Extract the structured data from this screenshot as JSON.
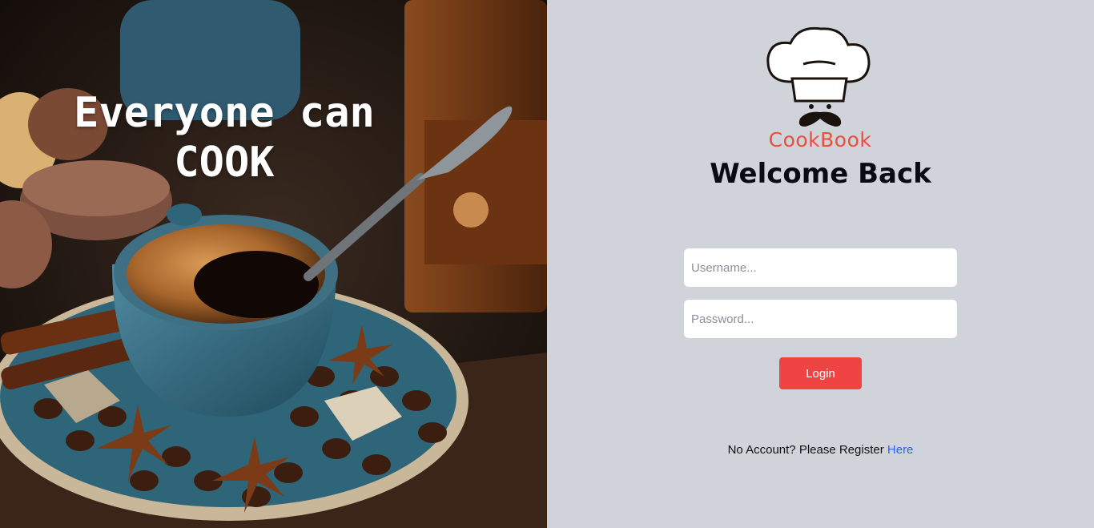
{
  "hero": {
    "line1": "Everyone can",
    "line2": "COOK"
  },
  "brand": {
    "name": "CookBook",
    "color": "#e94f3b"
  },
  "login_form": {
    "title": "Welcome Back",
    "username_placeholder": "Username...",
    "password_placeholder": "Password...",
    "login_label": "Login",
    "register_prompt": "No Account? Please Register",
    "register_link": "Here"
  },
  "colors": {
    "panel_background": "#d1d3da",
    "login_button": "#ef4444",
    "link": "#2563eb"
  },
  "icons": [
    "chef-hat-logo-icon"
  ],
  "image": "coffee-cup-with-macarons-and-coffee-beans"
}
